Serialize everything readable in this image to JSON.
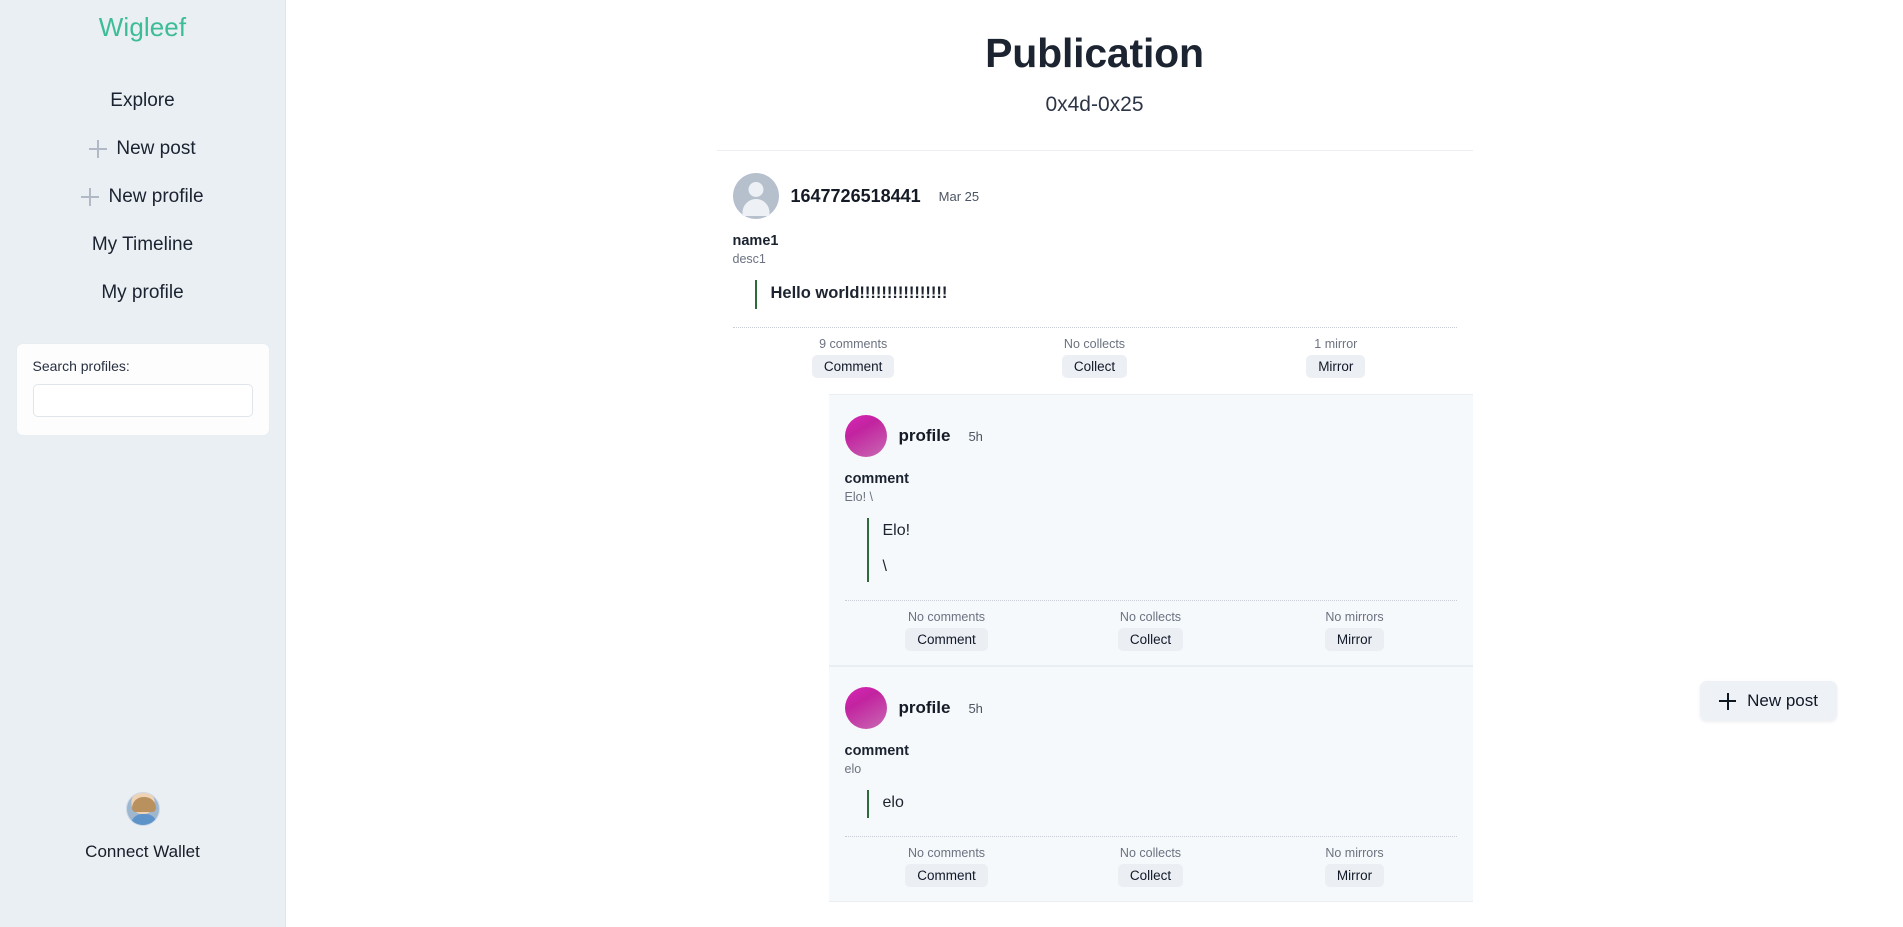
{
  "sidebar": {
    "brand": "Wigleef",
    "nav": [
      {
        "label": "Explore",
        "icon": null
      },
      {
        "label": "New post",
        "icon": "plus-icon"
      },
      {
        "label": "New profile",
        "icon": "plus-icon"
      },
      {
        "label": "My Timeline",
        "icon": null
      },
      {
        "label": "My profile",
        "icon": null
      }
    ],
    "search": {
      "label": "Search profiles:",
      "value": "",
      "placeholder": ""
    },
    "wallet": {
      "label": "Connect Wallet",
      "avatar_icon": "user-avatar-icon"
    }
  },
  "header": {
    "title": "Publication",
    "subtitle": "0x4d-0x25"
  },
  "fab": {
    "label": "New post",
    "icon": "plus-icon"
  },
  "post": {
    "avatar_icon": "default-user-avatar-icon",
    "handle": "1647726518441",
    "time": "Mar 25",
    "profile_name": "name1",
    "profile_desc": "desc1",
    "body_lines": [
      "Hello world!!!!!!!!!!!!!!!!"
    ],
    "stats": [
      {
        "count": "9 comments",
        "action": "Comment"
      },
      {
        "count": "No collects",
        "action": "Collect"
      },
      {
        "count": "1 mirror",
        "action": "Mirror"
      }
    ]
  },
  "comments": [
    {
      "avatar_icon": "gradient-avatar-icon",
      "handle": "profile",
      "time": "5h",
      "profile_name": "comment",
      "profile_desc": "Elo! \\",
      "body_lines": [
        "Elo!",
        "\\"
      ],
      "stats": [
        {
          "count": "No comments",
          "action": "Comment"
        },
        {
          "count": "No collects",
          "action": "Collect"
        },
        {
          "count": "No mirrors",
          "action": "Mirror"
        }
      ]
    },
    {
      "avatar_icon": "gradient-avatar-icon",
      "handle": "profile",
      "time": "5h",
      "profile_name": "comment",
      "profile_desc": "elo",
      "body_lines": [
        "elo"
      ],
      "stats": [
        {
          "count": "No comments",
          "action": "Comment"
        },
        {
          "count": "No collects",
          "action": "Collect"
        },
        {
          "count": "No mirrors",
          "action": "Mirror"
        }
      ]
    }
  ],
  "colors": {
    "brand": "#3dbd96",
    "sidebar_bg": "#eaeff4",
    "quote_bar": "#2f6b3a",
    "comment_bg": "#f6f9fb",
    "avatar_gradient_from": "#d927b9",
    "avatar_gradient_to": "#c86ab3"
  }
}
